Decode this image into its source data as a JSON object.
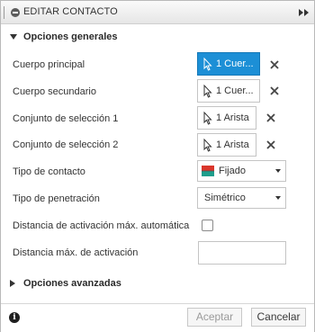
{
  "dialog": {
    "title": "EDITAR CONTACTO"
  },
  "sections": {
    "general": {
      "label": "Opciones generales",
      "expanded": true
    },
    "advanced": {
      "label": "Opciones avanzadas",
      "expanded": false
    }
  },
  "rows": {
    "main_body": {
      "label": "Cuerpo principal",
      "selection": "1 Cuer...",
      "active": true
    },
    "secondary_body": {
      "label": "Cuerpo secundario",
      "selection": "1 Cuer..."
    },
    "selection_set_1": {
      "label": "Conjunto de selección 1",
      "selection": "1 Arista"
    },
    "selection_set_2": {
      "label": "Conjunto de selección 2",
      "selection": "1 Arista"
    },
    "contact_type": {
      "label": "Tipo de contacto",
      "value": "Fijado",
      "icon": "contact-bonded-icon"
    },
    "penetration_type": {
      "label": "Tipo de penetración",
      "value": "Simétrico"
    },
    "auto_activation_distance": {
      "label": "Distancia de activación máx. automática",
      "checked": false
    },
    "max_activation_distance": {
      "label": "Distancia máx. de activación",
      "value": ""
    }
  },
  "footer": {
    "ok_label": "Aceptar",
    "cancel_label": "Cancelar",
    "info_icon": "i"
  },
  "colors": {
    "accent": "#1c8fd6",
    "icon_red": "#d9362b",
    "icon_teal": "#1e9e8c"
  }
}
